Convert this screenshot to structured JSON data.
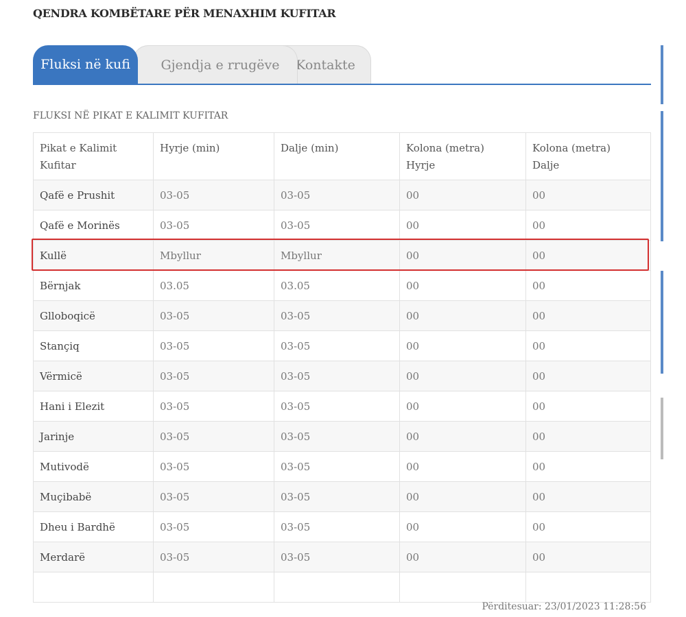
{
  "page": {
    "title": "QENDRA KOMBËTARE PËR MENAXHIM KUFITAR",
    "section_title": "FLUKSI NË PIKAT E KALIMIT KUFITAR",
    "updated": "Përditesuar: 23/01/2023 11:28:56",
    "accent_color": "#3a76c0",
    "highlight_color": "#d32f2f",
    "highlighted_row": "Kullë"
  },
  "tabs": [
    {
      "label": "Fluksi në kufi",
      "active": true
    },
    {
      "label": "Gjendja e rrugëve",
      "active": false
    },
    {
      "label": "Kontakte",
      "active": false
    }
  ],
  "table": {
    "headers": [
      [
        "Pikat e Kalimit",
        "Kufitar"
      ],
      [
        "Hyrje (min)",
        ""
      ],
      [
        "Dalje (min)",
        ""
      ],
      [
        "Kolona (metra)",
        "Hyrje"
      ],
      [
        "Kolona (metra)",
        "Dalje"
      ]
    ],
    "rows": [
      [
        "Qafë e Prushit",
        "03-05",
        "03-05",
        "00",
        "00"
      ],
      [
        "Qafë e Morinës",
        "03-05",
        "03-05",
        "00",
        "00"
      ],
      [
        "Kullë",
        "Mbyllur",
        "Mbyllur",
        "00",
        "00"
      ],
      [
        "Bërnjak",
        "03.05",
        "03.05",
        "00",
        "00"
      ],
      [
        "Glloboqicë",
        "03-05",
        "03-05",
        "00",
        "00"
      ],
      [
        "Stançiq",
        "03-05",
        "03-05",
        "00",
        "00"
      ],
      [
        "Vërmicë",
        "03-05",
        "03-05",
        "00",
        "00"
      ],
      [
        "Hani i Elezit",
        "03-05",
        "03-05",
        "00",
        "00"
      ],
      [
        "Jarinje",
        "03-05",
        "03-05",
        "00",
        "00"
      ],
      [
        "Mutivodë",
        "03-05",
        "03-05",
        "00",
        "00"
      ],
      [
        "Muçibabë",
        "03-05",
        "03-05",
        "00",
        "00"
      ],
      [
        "Dheu i Bardhë",
        "03-05",
        "03-05",
        "00",
        "00"
      ],
      [
        "Merdarë",
        "03-05",
        "03-05",
        "00",
        "00"
      ],
      [
        "",
        "",
        "",
        "",
        ""
      ]
    ]
  }
}
